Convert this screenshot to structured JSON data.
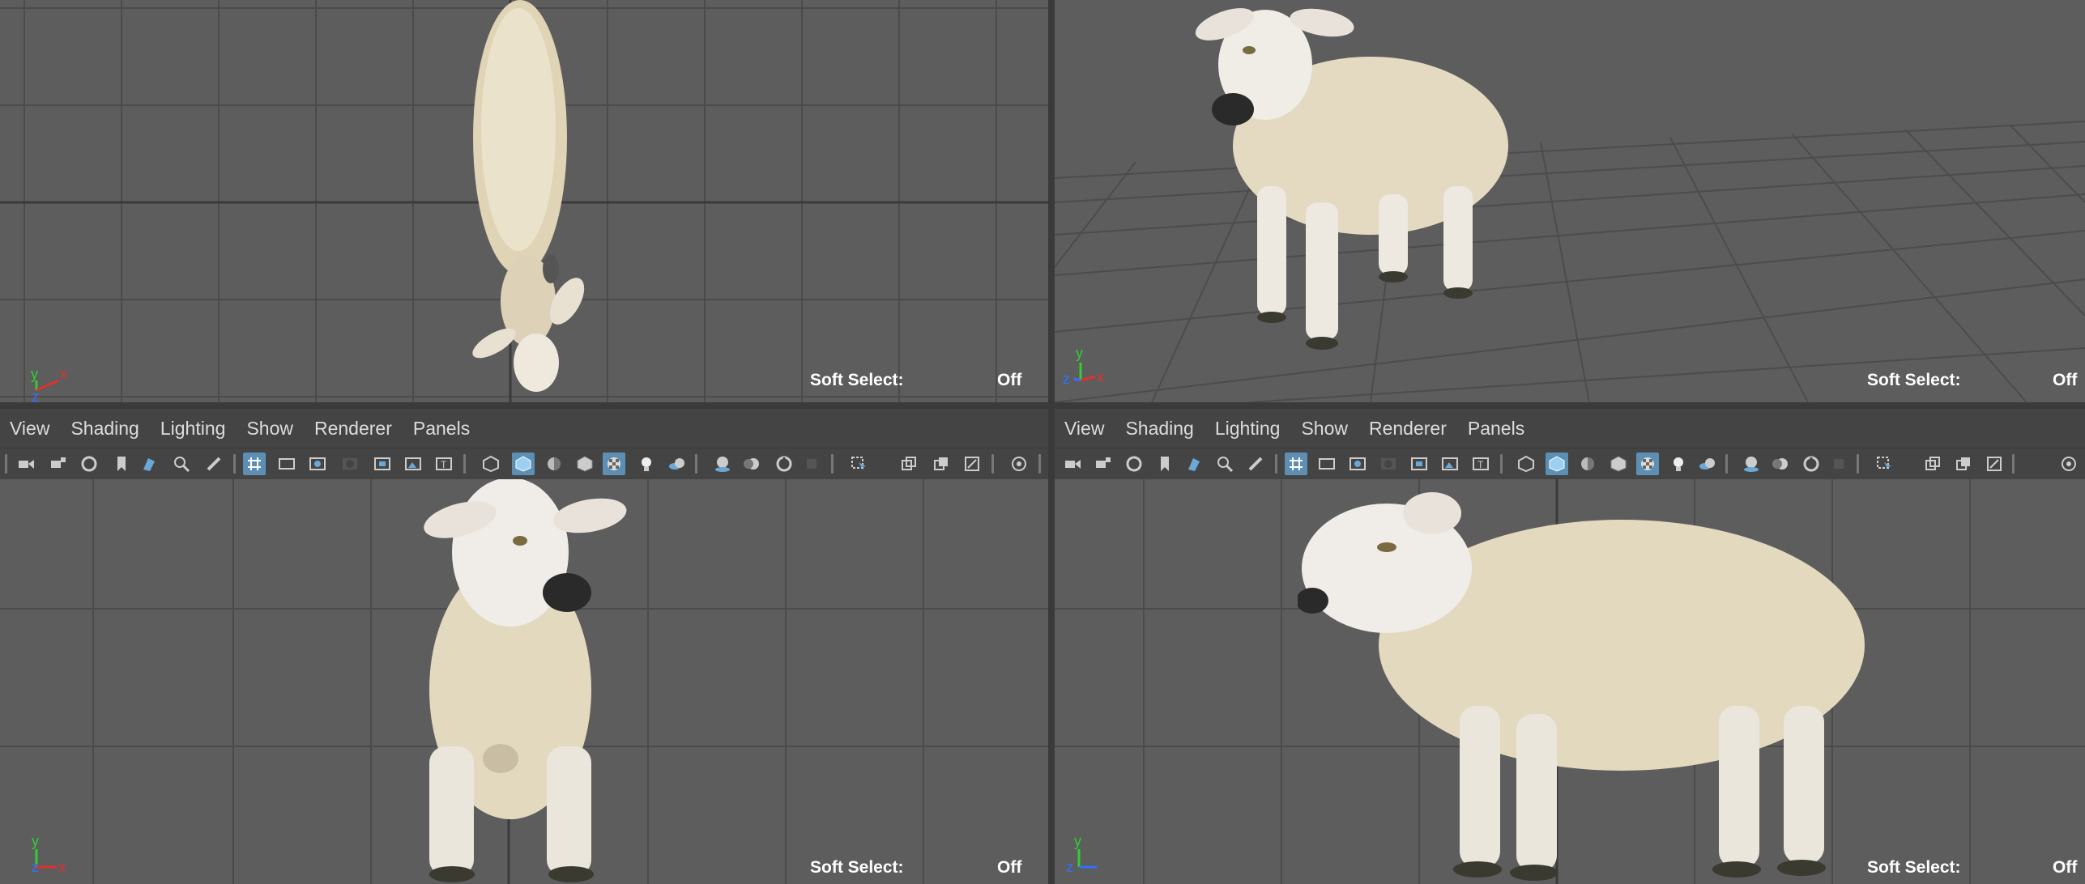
{
  "menus": {
    "view": "View",
    "shading": "Shading",
    "lighting": "Lighting",
    "show": "Show",
    "renderer": "Renderer",
    "panels": "Panels"
  },
  "viewports": {
    "top": {
      "soft_label": "Soft Select:",
      "soft_value": "Off"
    },
    "persp": {
      "soft_label": "Soft Select:",
      "soft_value": "Off"
    },
    "front": {
      "soft_label": "Soft Select:",
      "soft_value": "Off"
    },
    "side": {
      "soft_label": "Soft Select:",
      "soft_value": "Off"
    }
  },
  "axis_labels": {
    "x": "x",
    "y": "y",
    "z": "z"
  },
  "colors": {
    "viewport_bg": "#5d5d5d",
    "grid": "#4a4a4a",
    "active_icon": "#5c8fb3",
    "axis_x": "#e03030",
    "axis_y": "#30d030",
    "axis_z": "#3070ff",
    "wool": "#e6dcc4"
  },
  "toolbar_icons": [
    "camera-icon",
    "camera-lock-icon",
    "camera-attributes-icon",
    "bookmark-icon",
    "image-plane-icon",
    "track-camera-icon",
    "grease-pencil-icon",
    "grid-icon",
    "film-gate-icon",
    "resolution-gate-icon",
    "gate-mask-icon",
    "field-chart-icon",
    "safe-action-icon",
    "safe-title-icon",
    "wireframe-icon",
    "smooth-shade-icon",
    "default-material-icon",
    "wireframe-on-shaded-icon",
    "textured-icon",
    "use-all-lights-icon",
    "shadows-icon",
    "screen-space-ao-icon",
    "motion-blur-icon",
    "anti-alias-icon",
    "depth-of-field-icon",
    "isolate-select-icon",
    "xray-icon",
    "xray-joints-icon",
    "xray-components-icon",
    "exposure-icon"
  ]
}
